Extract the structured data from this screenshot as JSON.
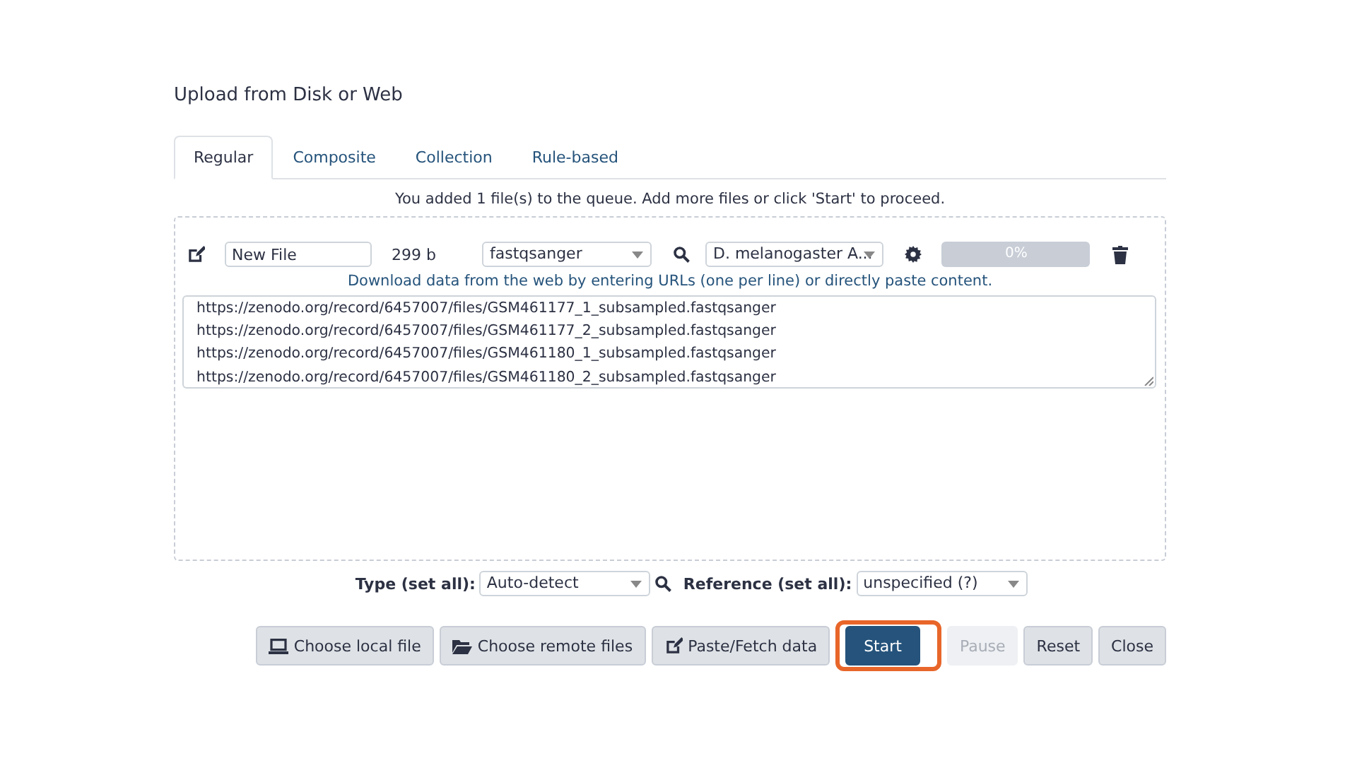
{
  "dialog": {
    "title": "Upload from Disk or Web"
  },
  "tabs": [
    {
      "label": "Regular",
      "selected": true
    },
    {
      "label": "Composite",
      "selected": false
    },
    {
      "label": "Collection",
      "selected": false
    },
    {
      "label": "Rule-based",
      "selected": false
    }
  ],
  "queue_message": "You added 1 file(s) to the queue. Add more files or click 'Start' to proceed.",
  "upload_item": {
    "name": "New File",
    "size": "299 b",
    "type": "fastqsanger",
    "reference": "D. melanogaster A...",
    "progress_label": "0%",
    "level": 0,
    "hint": "Download data from the web by entering URLs (one per line) or directly paste content.",
    "content": [
      "https://zenodo.org/record/6457007/files/GSM461177_1_subsampled.fastqsanger",
      "https://zenodo.org/record/6457007/files/GSM461177_2_subsampled.fastqsanger",
      "https://zenodo.org/record/6457007/files/GSM461180_1_subsampled.fastqsanger",
      "https://zenodo.org/record/6457007/files/GSM461180_2_subsampled.fastqsanger"
    ]
  },
  "set_all": {
    "type_label": "Type (set all):",
    "type_value": "Auto-detect",
    "reference_label": "Reference (set all):",
    "reference_value": "unspecified (?)"
  },
  "buttons": [
    {
      "label": "Choose local file",
      "kind": "secondary",
      "disabled": false,
      "highlighted": false
    },
    {
      "label": "Choose remote files",
      "kind": "secondary",
      "disabled": false,
      "highlighted": false
    },
    {
      "label": "Paste/Fetch data",
      "kind": "secondary",
      "disabled": false,
      "highlighted": false
    },
    {
      "label": "Start",
      "kind": "primary",
      "disabled": false,
      "highlighted": true
    },
    {
      "label": "Pause",
      "kind": "secondary",
      "disabled": true,
      "highlighted": false
    },
    {
      "label": "Reset",
      "kind": "secondary",
      "disabled": false,
      "highlighted": false
    },
    {
      "label": "Close",
      "kind": "secondary",
      "disabled": false,
      "highlighted": false
    }
  ]
}
